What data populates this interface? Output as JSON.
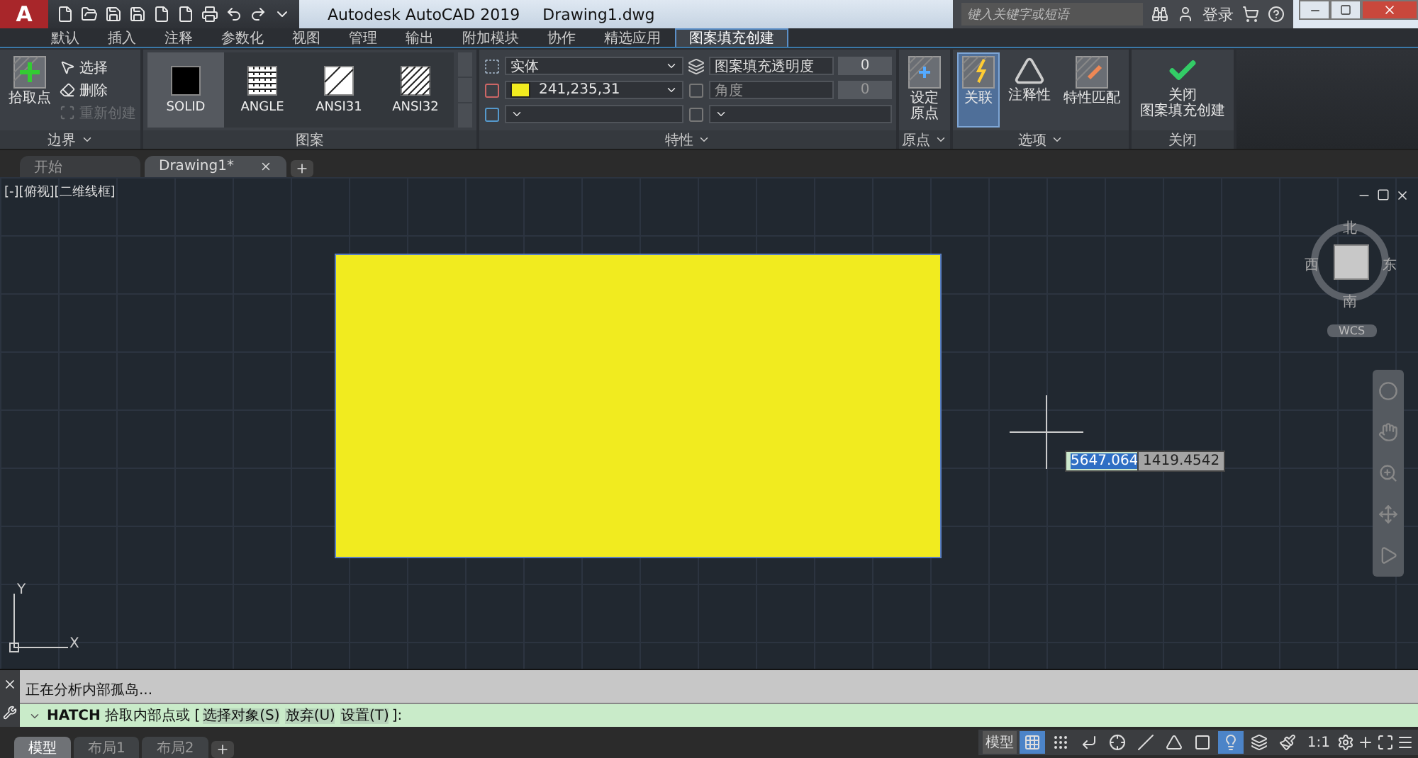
{
  "title_bar": {
    "app": "A",
    "title": "Autodesk AutoCAD 2019",
    "document": "Drawing1.dwg",
    "search": {
      "placeholder": "键入关键字或短语"
    },
    "sign_in": "登录"
  },
  "ribbon_tabs": [
    {
      "label": "默认",
      "selected": false
    },
    {
      "label": "插入",
      "selected": false
    },
    {
      "label": "注释",
      "selected": false
    },
    {
      "label": "参数化",
      "selected": false
    },
    {
      "label": "视图",
      "selected": false
    },
    {
      "label": "管理",
      "selected": false
    },
    {
      "label": "输出",
      "selected": false
    },
    {
      "label": "附加模块",
      "selected": false
    },
    {
      "label": "协作",
      "selected": false
    },
    {
      "label": "精选应用",
      "selected": false
    },
    {
      "label": "图案填充创建",
      "selected": true
    }
  ],
  "boundary_panel": {
    "title": "边界",
    "pick": "拾取点",
    "tools": [
      {
        "label": "选择",
        "disabled": false
      },
      {
        "label": "删除",
        "disabled": false
      },
      {
        "label": "重新创建",
        "disabled": true
      }
    ]
  },
  "pattern_panel": {
    "title": "图案",
    "patterns": [
      {
        "label": "SOLID",
        "kind": "solid",
        "selected": true
      },
      {
        "label": "ANGLE",
        "kind": "grid",
        "selected": false
      },
      {
        "label": "ANSI31",
        "kind": "single",
        "selected": false
      },
      {
        "label": "ANSI32",
        "kind": "double",
        "selected": false
      }
    ]
  },
  "properties_panel": {
    "title": "特性",
    "type": "实体",
    "color": {
      "value": "241,235,31",
      "color": "#f1eb1f"
    },
    "transparency": {
      "label": "图案填充透明度",
      "value": "0"
    },
    "angle": {
      "label": "角度",
      "value": "0"
    }
  },
  "origin_panel": {
    "title": "原点",
    "button": [
      "设定",
      "原点"
    ]
  },
  "options_panel": {
    "title": "选项",
    "buttons": [
      {
        "label": "关联",
        "selected": true
      },
      {
        "label": "注释性",
        "selected": false
      },
      {
        "label": "特性匹配",
        "selected": false
      }
    ]
  },
  "close_panel": {
    "title": "关闭",
    "button": [
      "关闭",
      "图案填充创建"
    ]
  },
  "file_tabs": [
    {
      "label": "开始",
      "selected": false
    },
    {
      "label": "Drawing1*",
      "selected": true
    }
  ],
  "viewport": {
    "label": "[-][俯视][二维线框]",
    "compass": {
      "north": "北",
      "south": "南",
      "east": "东",
      "west": "西"
    },
    "ucs": "WCS",
    "axis_x": "X",
    "axis_y": "Y",
    "coords": [
      {
        "value": "5647.064",
        "selected": true
      },
      {
        "value": "1419.4542",
        "selected": false
      }
    ]
  },
  "command_line": {
    "history": "正在分析内部孤岛...",
    "command": "HATCH",
    "prompt": "拾取内部点或",
    "open": "[",
    "options": [
      "选择对象(S)",
      "放弃(U)",
      "设置(T)"
    ],
    "close": "]:"
  },
  "layout_tabs": [
    {
      "label": "模型",
      "selected": true
    },
    {
      "label": "布局1",
      "selected": false
    },
    {
      "label": "布局2",
      "selected": false
    }
  ],
  "status_bar": {
    "space": "模型",
    "scale": "1:1",
    "toggles": [
      {
        "on": true
      },
      {
        "on": false
      },
      {
        "on": false
      },
      {
        "on": false
      },
      {
        "on": false
      },
      {
        "on": false
      },
      {
        "on": false
      },
      {
        "on": true
      },
      {
        "on": false
      },
      {
        "on": false
      }
    ]
  }
}
